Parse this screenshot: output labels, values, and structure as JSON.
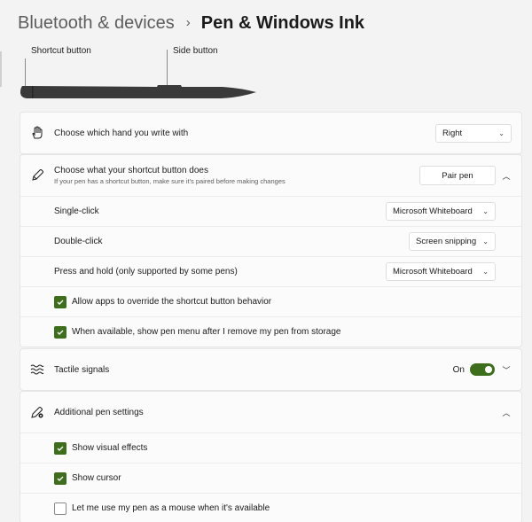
{
  "breadcrumb": {
    "parent": "Bluetooth & devices",
    "separator": "›",
    "current": "Pen & Windows Ink"
  },
  "pen": {
    "shortcut_label": "Shortcut button",
    "side_label": "Side button",
    "color": "#3a3a3a"
  },
  "handedness": {
    "title": "Choose which hand you write with",
    "value": "Right",
    "icon": "hand-icon"
  },
  "shortcut": {
    "title": "Choose what your shortcut button does",
    "subtitle": "If your pen has a shortcut button, make sure it's paired before making changes",
    "pair_button": "Pair pen",
    "icon": "pen-icon",
    "rows": [
      {
        "label": "Single-click",
        "value": "Microsoft Whiteboard"
      },
      {
        "label": "Double-click",
        "value": "Screen snipping"
      },
      {
        "label": "Press and hold (only supported by some pens)",
        "value": "Microsoft Whiteboard"
      }
    ],
    "checkboxes": [
      {
        "label": "Allow apps to override the shortcut button behavior",
        "checked": true
      },
      {
        "label": "When available, show pen menu after I remove my pen from storage",
        "checked": true
      }
    ]
  },
  "tactile": {
    "title": "Tactile signals",
    "state": "On",
    "icon": "vibration-icon"
  },
  "additional": {
    "title": "Additional pen settings",
    "icon": "pen-settings-icon",
    "checkboxes": [
      {
        "label": "Show visual effects",
        "checked": true
      },
      {
        "label": "Show cursor",
        "checked": true
      },
      {
        "label": "Let me use my pen as a mouse when it's available",
        "checked": false
      }
    ]
  },
  "colors": {
    "accent": "#3c6e1c",
    "background": "#f3f3f3",
    "card": "#fbfbfb"
  }
}
